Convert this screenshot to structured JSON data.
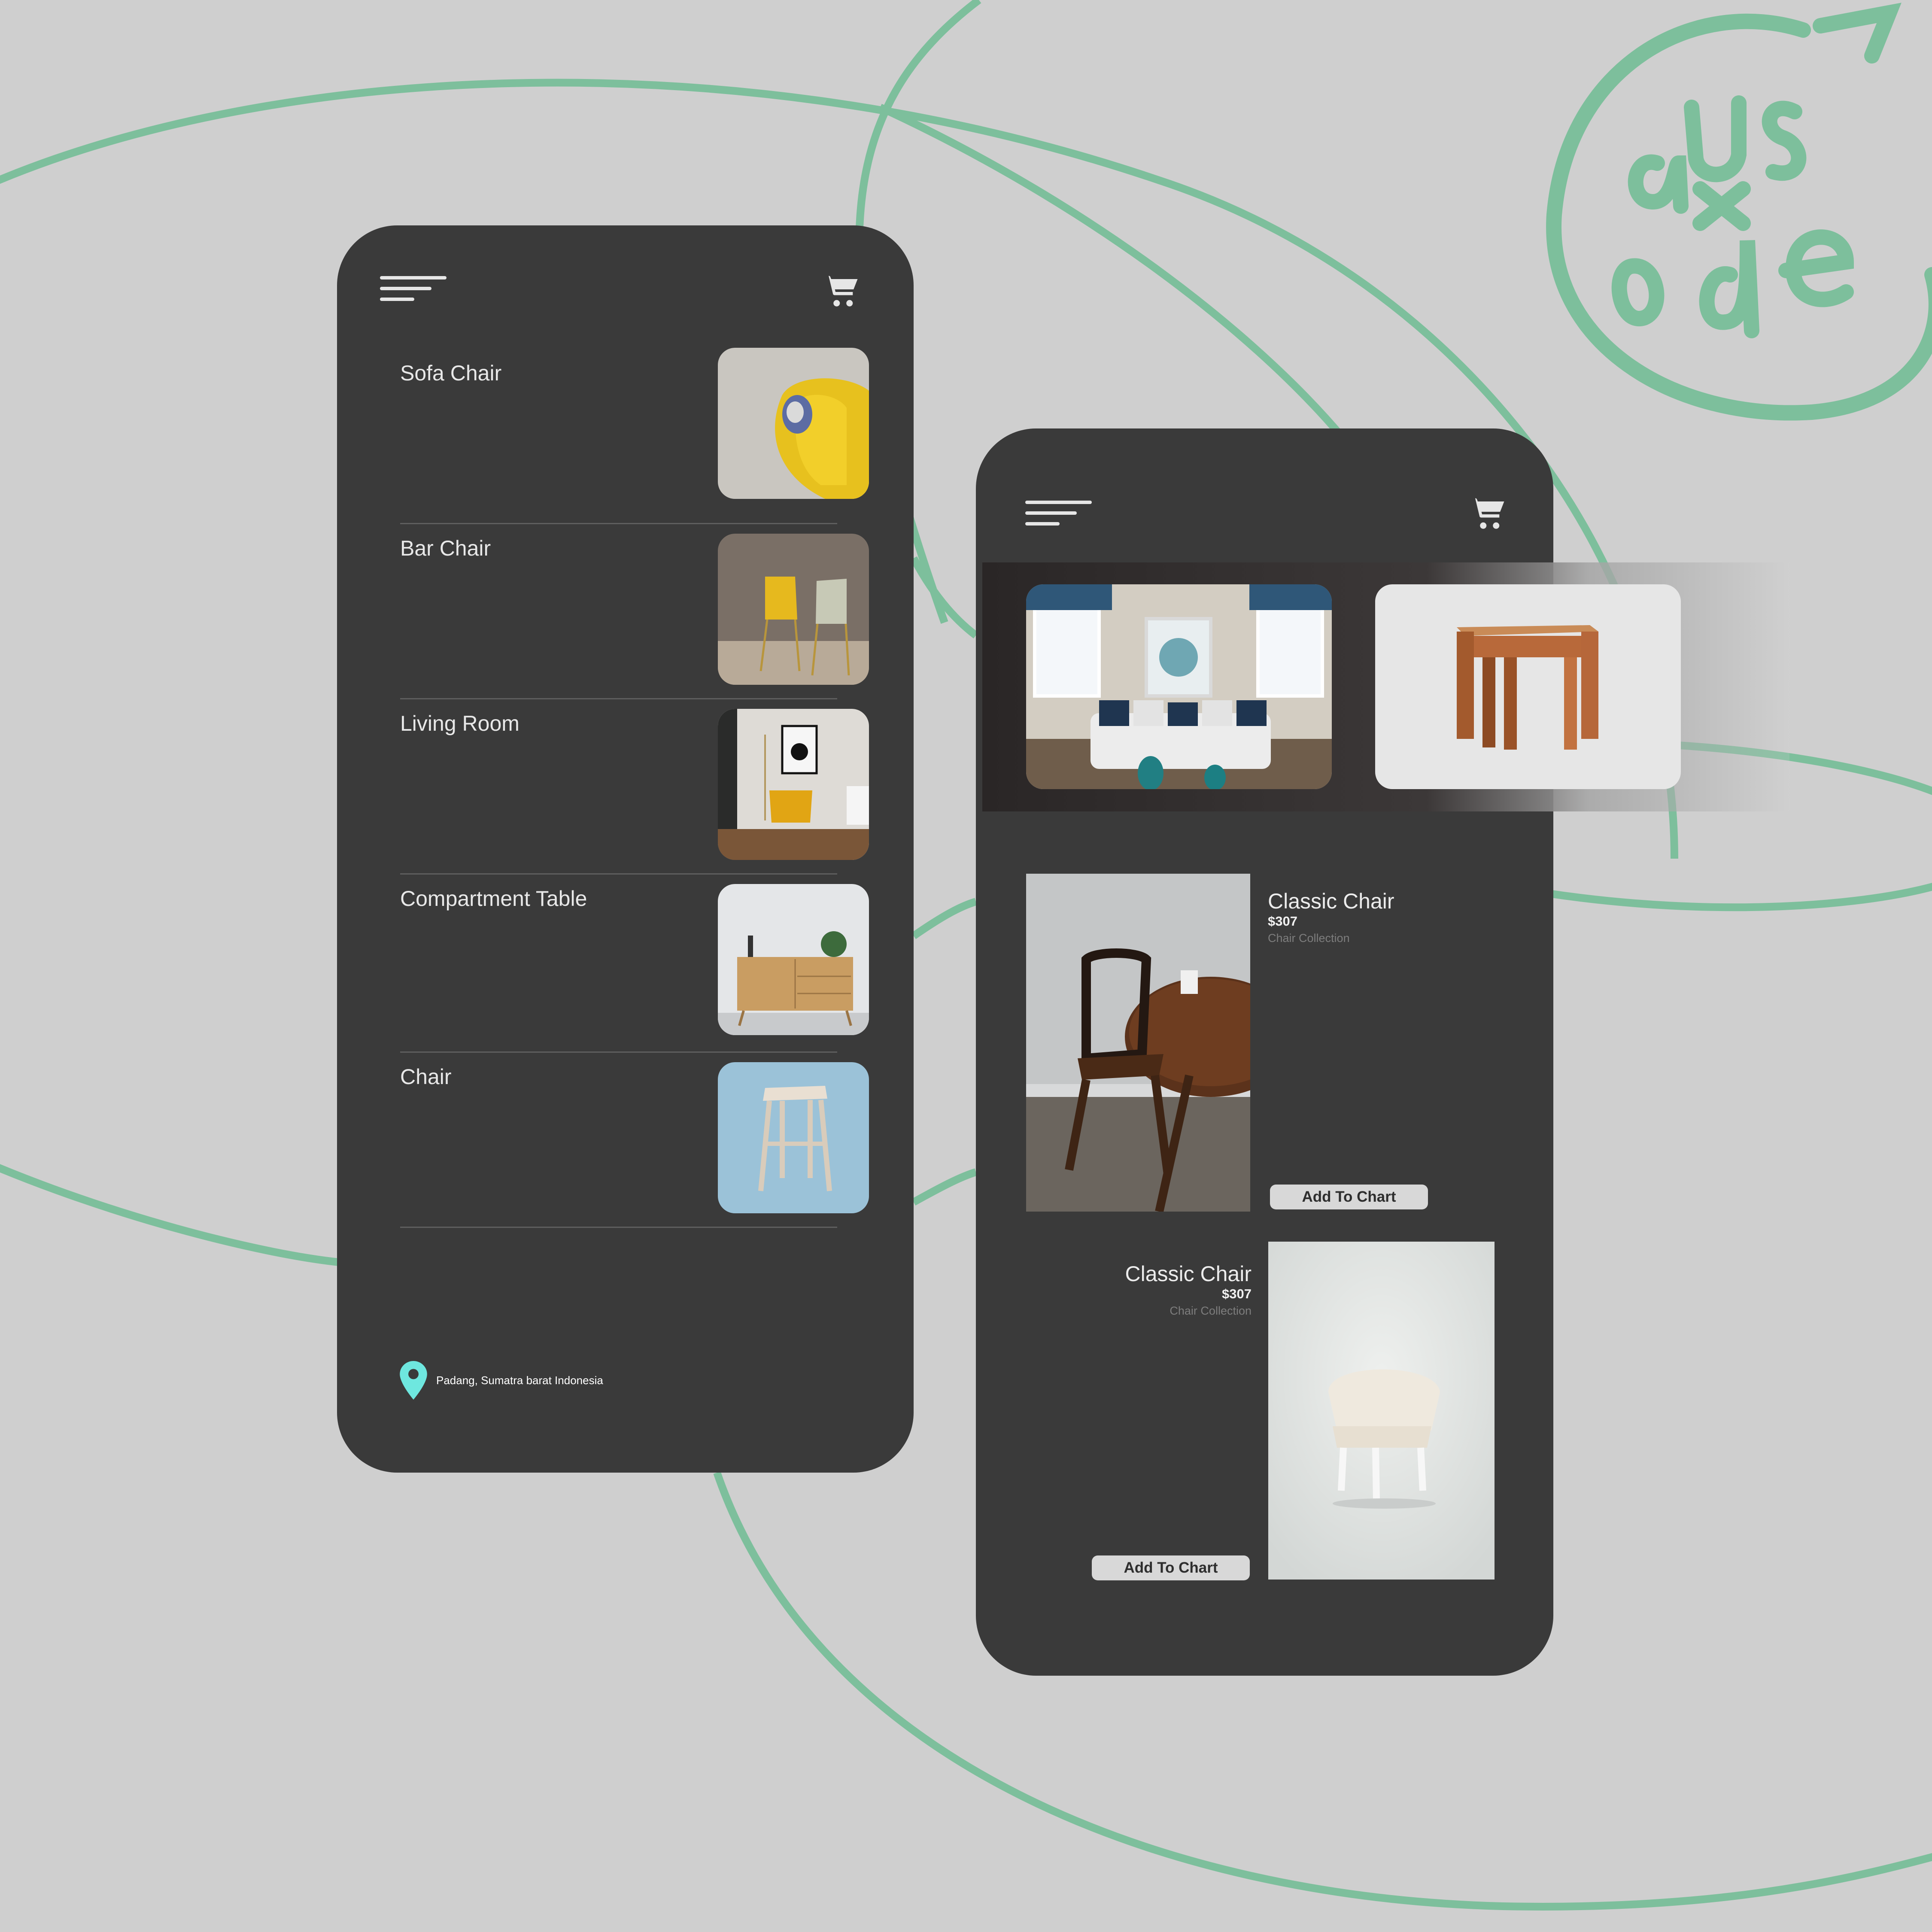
{
  "colors": {
    "background": "#cfcfcf",
    "phone": "#3a3a3a",
    "accent_green": "#7dbf9c",
    "location_pin": "#6ee7df",
    "button": "#d8d8d8"
  },
  "logo": {
    "text": "aUs x ode"
  },
  "left_screen": {
    "menu_icon": "hamburger-menu-icon",
    "cart_icon": "shopping-cart-icon",
    "items": [
      {
        "label": "Sofa Chair",
        "image": "yellow-sofa-photo"
      },
      {
        "label": "Bar Chair",
        "image": "bar-chairs-photo"
      },
      {
        "label": "Living Room",
        "image": "living-room-photo"
      },
      {
        "label": "Compartment Table",
        "image": "wooden-cabinet-photo"
      },
      {
        "label": "Chair",
        "image": "wooden-stool-photo"
      }
    ],
    "location": {
      "icon": "location-pin-icon",
      "text": "Padang, Sumatra barat Indonesia"
    }
  },
  "right_screen": {
    "menu_icon": "hamburger-menu-icon",
    "cart_icon": "shopping-cart-icon",
    "carousel": [
      {
        "image": "living-room-sofa-photo"
      },
      {
        "image": "nesting-tables-photo"
      }
    ],
    "products": [
      {
        "title": "Classic Chair",
        "price": "$307",
        "collection": "Chair Collection",
        "button": "Add To Chart",
        "image": "wooden-chair-table-photo"
      },
      {
        "title": "Classic Chair",
        "price": "$307",
        "collection": "Chair Collection",
        "button": "Add To Chart",
        "image": "white-tufted-chair-photo"
      }
    ]
  }
}
